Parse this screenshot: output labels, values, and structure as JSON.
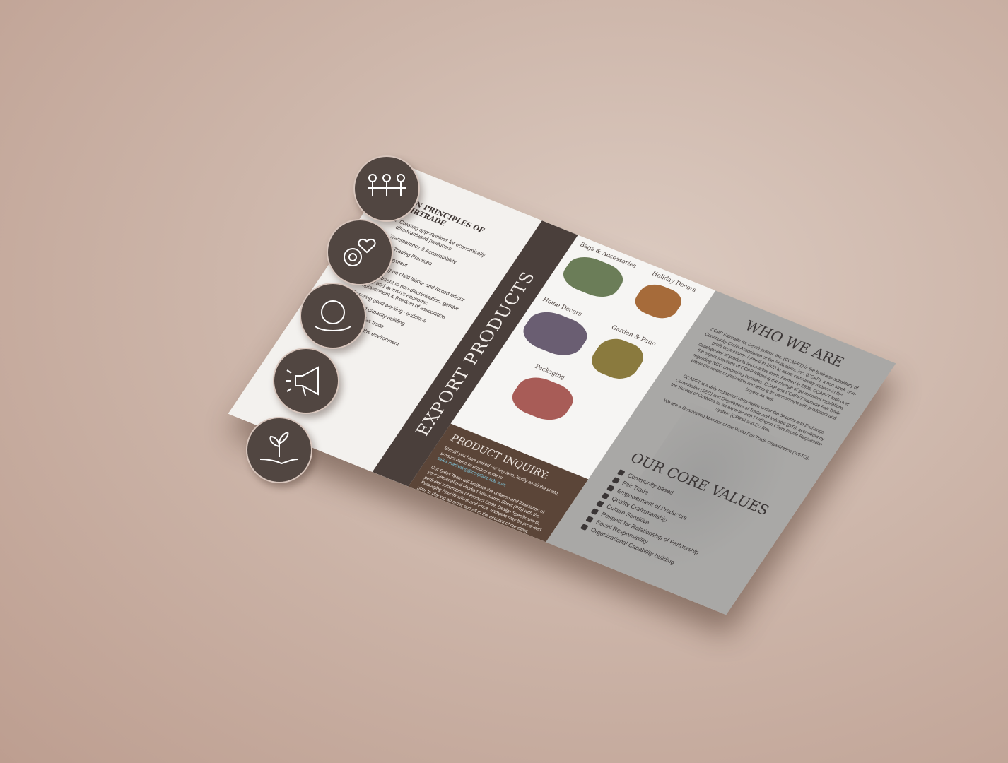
{
  "principles": {
    "title": "TEN PRINCIPLES OF FAIRTRADE",
    "items": [
      {
        "num": "1.",
        "text": "Creating opportunities for economically disadvantaged producers"
      },
      {
        "num": "2.",
        "text": "Transparency & Accountability"
      },
      {
        "num": "3.",
        "text": "Fair Trading Practices"
      },
      {
        "num": "4.",
        "text": "Fair Payment"
      },
      {
        "num": "5.",
        "text": "Ensuring no child labour and forced labour"
      },
      {
        "num": "6.",
        "text": "Commitment to non-discrimination, gender equity and women's economic empowerment & freedom of association"
      },
      {
        "num": "7.",
        "text": "Ensuring good working conditions"
      },
      {
        "num": "8.",
        "text": "Providing capacity building"
      },
      {
        "num": "9.",
        "text": "Promoting fair trade"
      },
      {
        "num": "10.",
        "text": "Respect for the environment"
      }
    ]
  },
  "export": {
    "title": "EXPORT PRODUCTS",
    "categories": {
      "bags": "Bags & Accessories",
      "holiday": "Holiday Decors",
      "home": "Home Decors",
      "garden": "Garden & Patio",
      "packaging": "Packaging"
    }
  },
  "inquiry": {
    "title": "PRODUCT INQUIRY:",
    "text1": "Should you have picked out any item, kindly email the photo, product name or product code to",
    "email": "sales.marketing@ccapfairtrade.com",
    "text2": "Our Sales Team will facilitate the collation and finalization of your personalized Product Information Sheet (PIS) with the pertinent information of Product Code, Design Specifications, Packaging Specifications and Price. Samples may be produced prior to placing an order and all to the account of the client."
  },
  "who": {
    "title": "WHO WE ARE",
    "p1": "CCAP Fairtrade for Development, Inc. (CCAPFT) is the business subsidiary of Community Crafts Association of the Philippines, Inc. (CCAP), a non-stock, non-profit organization formed in 1973 to assist community artisans in the development of products and market them. Formed in 1998, CCAPFT took over the export functions of CCAP following the change of government regulations regarding NGO conducting business. CCAP and CCAPFT espouse Fair Trade within the whole organization and among its partnerships with producers and buyers as well.",
    "p2": "CCAPFT is a duly registered corporation under the Security and Exchange Commission (SEC) and Department of Trade and Industry (DTI), accredited by the Bureau of Customs as an exporter with PhilExport Client Profile Registration System (CPRS) and EU Rex.",
    "p3": "We are a Guaranteed Member of the World Fair Trade Organization (WFTO)."
  },
  "core": {
    "title": "OUR CORE VALUES",
    "items": [
      "Community-based",
      "Fair Trade",
      "Empowerment of Producers",
      "Quality Craftsmanship",
      "Culture Sensitive",
      "Respect for Relationship of Partnership",
      "Social Responsibility",
      "Organizational Capability-building"
    ]
  },
  "colors": {
    "background": "#cdb6aa",
    "dark_band": "#4a3f3b",
    "inquiry_bg": "#5b4538",
    "grey_panel": "#a9a8a6",
    "circle_bg": "#514641"
  },
  "icons": [
    "people-holding-hands-icon",
    "gear-heart-icon",
    "puzzle-hand-icon",
    "megaphone-icon",
    "plant-hand-icon"
  ]
}
